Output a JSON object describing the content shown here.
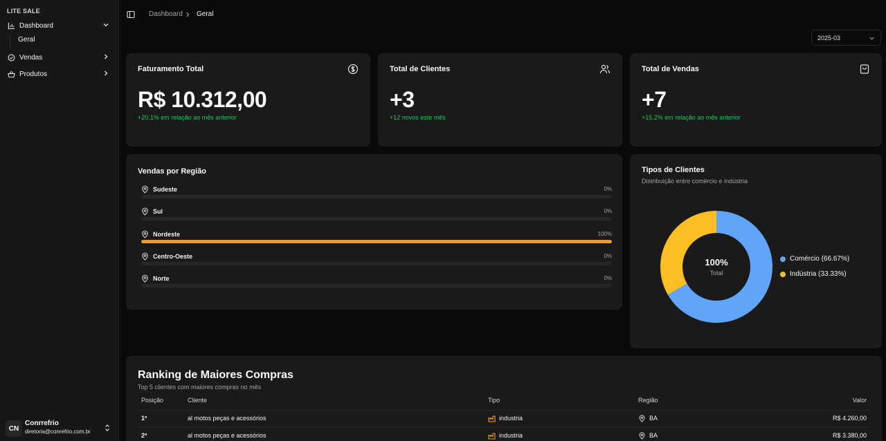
{
  "sidebar": {
    "brand": "LITE SALE",
    "items": [
      {
        "label": "Dashboard",
        "icon": "bar-chart-icon"
      },
      {
        "label": "Vendas",
        "icon": "check-circle-icon"
      },
      {
        "label": "Produtos",
        "icon": "basket-icon"
      }
    ],
    "subitem": "Geral",
    "user": {
      "initials": "CN",
      "name": "Conrrefrio",
      "email": "diretoria@conrefrio.com.br"
    }
  },
  "breadcrumb": {
    "parent": "Dashboard",
    "current": "Geral"
  },
  "month_select": {
    "value": "2025-03"
  },
  "stats": [
    {
      "title": "Faturamento Total",
      "value": "R$ 10.312,00",
      "sub": "+20.1% em relação ao mês anterior",
      "icon": "dollar-circle-icon"
    },
    {
      "title": "Total de Clientes",
      "value": "+3",
      "sub": "+12 novos este mês",
      "icon": "users-icon"
    },
    {
      "title": "Total de Vendas",
      "value": "+7",
      "sub": "+15.2% em relação ao mês anterior",
      "icon": "shopping-bag-icon"
    }
  ],
  "regions": {
    "title": "Vendas por Região",
    "bar_color": "#f59e0b",
    "items": [
      {
        "name": "Sudeste",
        "pct_label": "0%",
        "pct": 0
      },
      {
        "name": "Sul",
        "pct_label": "0%",
        "pct": 0
      },
      {
        "name": "Nordeste",
        "pct_label": "100%",
        "pct": 100
      },
      {
        "name": "Centro-Oeste",
        "pct_label": "0%",
        "pct": 0
      },
      {
        "name": "Norte",
        "pct_label": "0%",
        "pct": 0
      }
    ]
  },
  "clients": {
    "title": "Tipos de Clientes",
    "subtitle": "Distribuição entre comércio e indústria",
    "center_value": "100%",
    "center_label": "Total",
    "legend": [
      {
        "label": "Comércio (66.67%)",
        "color": "#60a5fa"
      },
      {
        "label": "Indústria (33.33%)",
        "color": "#fbbf24"
      }
    ]
  },
  "chart_data": {
    "type": "pie",
    "categories": [
      "Comércio",
      "Indústria"
    ],
    "values": [
      66.67,
      33.33
    ],
    "colors": [
      "#60a5fa",
      "#fbbf24"
    ],
    "title": "Tipos de Clientes"
  },
  "ranking": {
    "title": "Ranking de Maiores Compras",
    "subtitle": "Top 5 clientes com maiores compras no mês",
    "columns": [
      "Posição",
      "Cliente",
      "Tipo",
      "Região",
      "Valor"
    ],
    "rows": [
      {
        "pos": "1º",
        "client": "al motos peças e acessórios",
        "type": "industria",
        "region": "BA",
        "value": "R$ 4.260,00"
      },
      {
        "pos": "2º",
        "client": "al motos peças e acessórios",
        "type": "industria",
        "region": "BA",
        "value": "R$ 3.380,00"
      }
    ]
  }
}
